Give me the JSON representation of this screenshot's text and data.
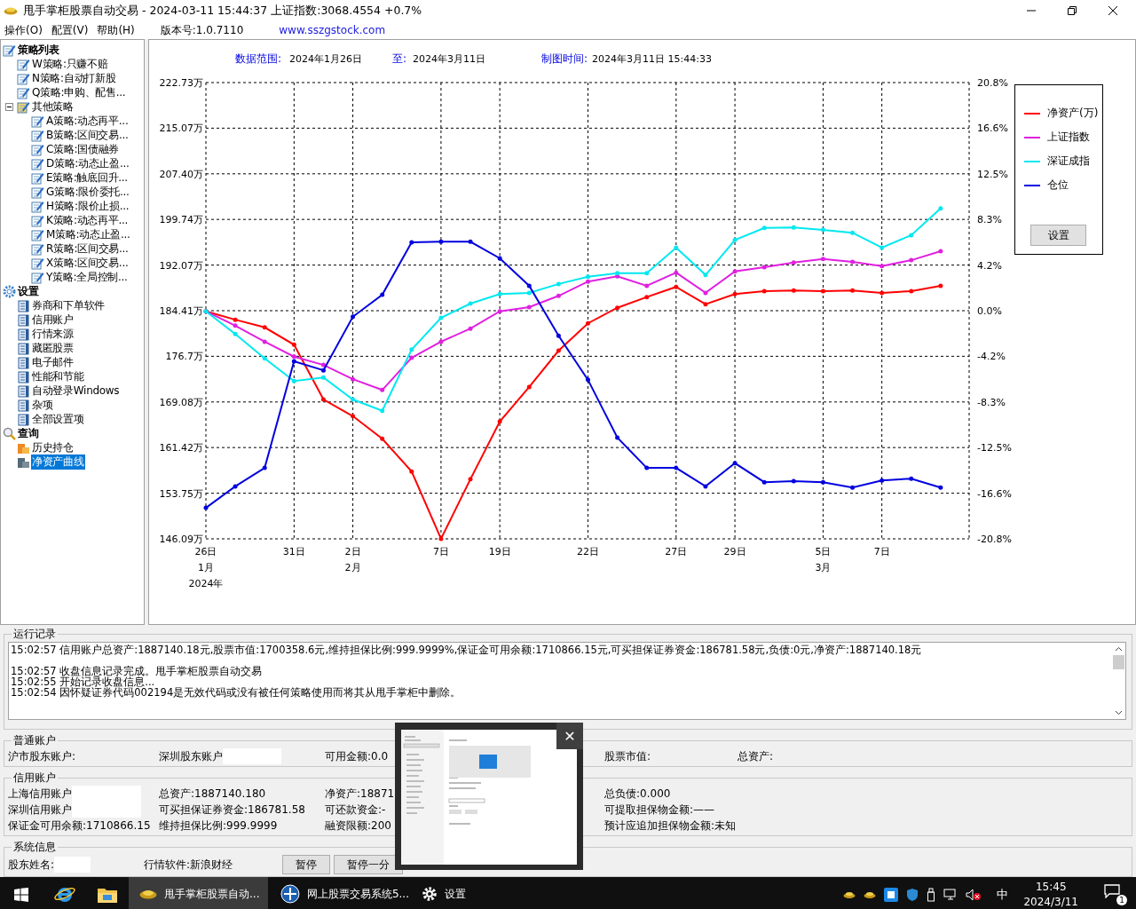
{
  "window": {
    "title": "甩手掌柜股票自动交易 - 2024-03-11 15:44:37 上证指数:3068.4554 +0.7%"
  },
  "menu": [
    "操作(O)",
    "配置(V)",
    "帮助(H)"
  ],
  "version": "版本号:1.0.7110",
  "website": "www.sszgstock.com",
  "sidebar": {
    "items": [
      {
        "label": "策略列表",
        "kind": "list",
        "selected": false,
        "children": [
          {
            "label": "W策略:只赚不赔",
            "kind": "strategy",
            "selected": false
          },
          {
            "label": "N策略:自动打新股",
            "kind": "strategy",
            "selected": false
          },
          {
            "label": "Q策略:申购、配售...",
            "kind": "strategy",
            "selected": false
          },
          {
            "label": "其他策略",
            "kind": "folder",
            "selected": false,
            "expanded": true,
            "children": [
              {
                "label": "A策略:动态再平...",
                "kind": "strategy",
                "selected": false
              },
              {
                "label": "B策略:区间交易...",
                "kind": "strategy",
                "selected": false
              },
              {
                "label": "C策略:国债融券",
                "kind": "strategy",
                "selected": false
              },
              {
                "label": "D策略:动态止盈...",
                "kind": "strategy",
                "selected": false
              },
              {
                "label": "E策略:触底回升...",
                "kind": "strategy",
                "selected": false
              },
              {
                "label": "G策略:限价委托...",
                "kind": "strategy",
                "selected": false
              },
              {
                "label": "H策略:限价止损...",
                "kind": "strategy",
                "selected": false
              },
              {
                "label": "K策略:动态再平...",
                "kind": "strategy",
                "selected": false
              },
              {
                "label": "M策略:动态止盈...",
                "kind": "strategy",
                "selected": false
              },
              {
                "label": "R策略:区间交易...",
                "kind": "strategy",
                "selected": false
              },
              {
                "label": "X策略:区间交易...",
                "kind": "strategy",
                "selected": false
              },
              {
                "label": "Y策略:全局控制...",
                "kind": "strategy",
                "selected": false
              }
            ]
          }
        ]
      },
      {
        "label": "设置",
        "kind": "gear",
        "selected": false,
        "children": [
          {
            "label": "券商和下单软件",
            "kind": "page",
            "selected": false
          },
          {
            "label": "信用账户",
            "kind": "page",
            "selected": false
          },
          {
            "label": "行情来源",
            "kind": "page",
            "selected": false
          },
          {
            "label": "藏匿股票",
            "kind": "page",
            "selected": false
          },
          {
            "label": "电子邮件",
            "kind": "page",
            "selected": false
          },
          {
            "label": "性能和节能",
            "kind": "page",
            "selected": false
          },
          {
            "label": "自动登录Windows",
            "kind": "page",
            "selected": false
          },
          {
            "label": "杂项",
            "kind": "page",
            "selected": false
          },
          {
            "label": "全部设置项",
            "kind": "page",
            "selected": false
          }
        ]
      },
      {
        "label": "查询",
        "kind": "search",
        "selected": false,
        "children": [
          {
            "label": "历史持仓",
            "kind": "coins",
            "selected": false
          },
          {
            "label": "净资产曲线",
            "kind": "chart",
            "selected": true
          }
        ]
      }
    ]
  },
  "chart": {
    "header": [
      {
        "label": "数据范围:",
        "value": "2024年1月26日"
      },
      {
        "label": "至:",
        "value": "2024年3月11日"
      },
      {
        "label": "制图时间:",
        "value": "2024年3月11日 15:44:33"
      }
    ],
    "right_axis_labels": [
      "20.8%",
      "16.6%",
      "12.5%",
      "8.3%",
      "4.2%",
      "0.0%",
      "-4.2%",
      "-8.3%",
      "-12.5%",
      "-16.6%",
      "-20.8%"
    ],
    "legend_button": "设置",
    "chart_data": {
      "type": "line",
      "grid": true,
      "categories": [
        "26日\n1月\n2024年",
        null,
        null,
        "31日",
        null,
        "2日\n2月",
        null,
        null,
        "7日",
        null,
        "19日",
        null,
        null,
        "22日",
        null,
        null,
        "27日",
        null,
        "29日",
        null,
        null,
        "5日\n3月",
        null,
        "7日",
        null,
        null
      ],
      "ylim": [
        146.09,
        222.73
      ],
      "yticks": [
        {
          "value": 222.73,
          "label": "222.73万"
        },
        {
          "value": 215.07,
          "label": "215.07万"
        },
        {
          "value": 207.4,
          "label": "207.40万"
        },
        {
          "value": 199.74,
          "label": "199.74万"
        },
        {
          "value": 192.07,
          "label": "192.07万"
        },
        {
          "value": 184.41,
          "label": "184.41万"
        },
        {
          "value": 176.75,
          "label": "176.7万"
        },
        {
          "value": 169.08,
          "label": "169.08万"
        },
        {
          "value": 161.42,
          "label": "161.42万"
        },
        {
          "value": 153.75,
          "label": "153.75万"
        },
        {
          "value": 146.09,
          "label": "146.09万"
        }
      ],
      "series": [
        {
          "name": "净资产(万)",
          "color": "#ff0000",
          "values": [
            184.3,
            182.9,
            181.6,
            178.7,
            169.5,
            166.7,
            162.9,
            157.4,
            146.1,
            156.1,
            165.8,
            171.6,
            177.7,
            182.3,
            184.9,
            186.7,
            188.4,
            185.5,
            187.2,
            187.7,
            187.8,
            187.7,
            187.8,
            187.4,
            187.7,
            188.6
          ]
        },
        {
          "name": "上证指数",
          "color": "#e020e0",
          "values": [
            184.3,
            181.9,
            179.2,
            176.7,
            175.3,
            172.9,
            171.1,
            176.5,
            179.2,
            181.4,
            184.3,
            185.0,
            186.9,
            189.3,
            190.2,
            188.6,
            190.8,
            187.4,
            191.0,
            191.7,
            192.5,
            193.1,
            192.6,
            191.9,
            192.9,
            194.4
          ]
        },
        {
          "name": "深证成指",
          "color": "#00e8f0",
          "values": [
            184.3,
            180.5,
            176.4,
            172.6,
            173.2,
            169.5,
            167.6,
            177.9,
            183.2,
            185.6,
            187.2,
            187.4,
            188.9,
            190.1,
            190.7,
            190.7,
            195.0,
            190.4,
            196.3,
            198.3,
            198.4,
            198.0,
            197.5,
            195.0,
            197.1,
            201.6
          ]
        },
        {
          "name": "仓位",
          "color": "#0000e0",
          "values": [
            151.3,
            154.9,
            158.0,
            175.9,
            174.4,
            183.4,
            187.1,
            195.9,
            196.0,
            196.0,
            193.2,
            188.6,
            180.2,
            172.8,
            163.1,
            158.0,
            158.0,
            154.9,
            158.8,
            155.6,
            155.8,
            155.6,
            154.7,
            155.9,
            156.2,
            154.7
          ]
        }
      ]
    }
  },
  "log": {
    "title": "运行记录",
    "lines": [
      "15:02:57 信用账户总资产:1887140.18元,股票市值:1700358.6元,维持担保比例:999.9999%,保证金可用余额:1710866.15元,可买担保证券资金:186781.58元,负债:0元,净资产:1887140.18元",
      "15:02:57 收盘信息记录完成。甩手掌柜股票自动交易",
      "15:02:55 开始记录收盘信息...",
      "15:02:54 因怀疑证券代码002194是无效代码或没有被任何策略使用而将其从甩手掌柜中删除。"
    ]
  },
  "accounts": [
    {
      "title": "普通账户",
      "rows": [
        [
          {
            "kind": "text",
            "text": "沪市股东账户:"
          },
          {
            "kind": "masked",
            "text": "深圳股东账户"
          },
          {
            "kind": "text",
            "text": "可用金额:0.0"
          },
          {
            "kind": "text",
            "text": "股票市值:"
          },
          {
            "kind": "text",
            "text": "总资产:"
          }
        ]
      ]
    },
    {
      "title": "信用账户",
      "rows": [
        [
          {
            "kind": "masked",
            "text": "上海信用账户"
          },
          {
            "kind": "text",
            "text": "总资产:1887140.180"
          },
          {
            "kind": "text",
            "text": "净资产:18871"
          },
          {
            "kind": "text",
            "text": "总负债:0.000"
          }
        ],
        [
          {
            "kind": "masked",
            "text": "深圳信用账户"
          },
          {
            "kind": "text",
            "text": "可买担保证券资金:186781.58"
          },
          {
            "kind": "text",
            "text": "可还款资金:-"
          },
          {
            "kind": "text",
            "text": "可提取担保物金额:——"
          }
        ],
        [
          {
            "kind": "text",
            "text": "保证金可用余额:1710866.15"
          },
          {
            "kind": "text",
            "text": "维持担保比例:999.9999"
          },
          {
            "kind": "text",
            "text": "融资限额:200"
          },
          {
            "kind": "text",
            "text": "预计应追加担保物金额:未知"
          }
        ]
      ]
    },
    {
      "title": "系统信息",
      "rows": [
        [
          {
            "kind": "masked",
            "text": "股东姓名:"
          },
          {
            "kind": "text",
            "text": "行情软件:新浪财经"
          },
          {
            "kind": "button",
            "text": "暂停"
          },
          {
            "kind": "button",
            "text": "暂停一分"
          }
        ]
      ]
    }
  ],
  "thumbnail": {
    "close": "✕"
  },
  "taskbar": {
    "tasks": [
      {
        "label": "甩手掌柜股票自动...",
        "kind": "ingot",
        "selected": true
      },
      {
        "label": "网上股票交易系统5...",
        "kind": "globe",
        "selected": false
      },
      {
        "label": "设置",
        "kind": "gear",
        "selected": false
      }
    ],
    "ime": "中",
    "time": "15:45",
    "date": "2024/3/11",
    "notifications": "1"
  }
}
